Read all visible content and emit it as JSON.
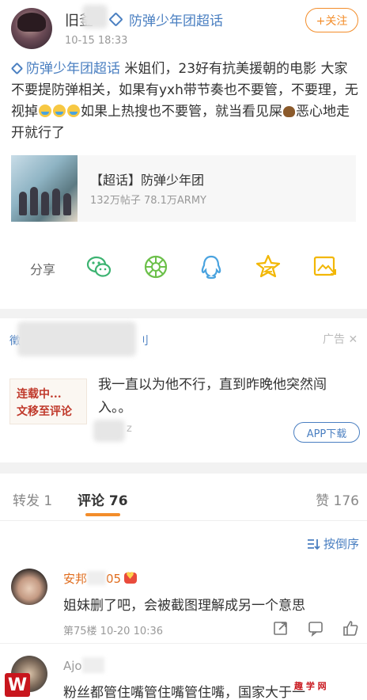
{
  "post": {
    "username": "旧釜",
    "super_topic_tag": "防弹少年团超话",
    "time": "10-15 18:33",
    "follow_label": "+关注",
    "topic_link": "防弹少年团超话",
    "body_1": " 米姐们，23好有抗美援朝的电影 大家不要提防弹相关，如果有yxh带节奏也不要管，不要理，无视掉",
    "body_2": "如果上热搜也不要管，就当看见屎",
    "body_3": "恶心地走开就行了",
    "emoji_icons": [
      "crying-face-icon",
      "crying-face-icon",
      "crying-face-icon"
    ],
    "poop_icon": "poop-icon"
  },
  "topic_card": {
    "title": "【超话】防弹少年团",
    "stats": "132万帖子 78.1万ARMY"
  },
  "share": {
    "label": "分享",
    "icons": [
      "wechat-icon",
      "moments-icon",
      "qq-icon",
      "qzone-icon",
      "save-image-icon"
    ]
  },
  "ad": {
    "advertiser": "徵",
    "advertiser_suffix": "刂",
    "label": "广告",
    "thumb_line_1": "连载中...",
    "thumb_line_2": "文移至评论",
    "text": "我一直以为他不行，直到昨晚他突然闯入。。",
    "meta": "z",
    "app_button": "APP下载"
  },
  "tabs": {
    "repost": "转发 1",
    "comments": "评论 76",
    "likes": "赞 176"
  },
  "sort": {
    "label": "按倒序"
  },
  "comments": [
    {
      "name": "安邦",
      "name_suffix": "05",
      "text": "姐妹删了吧，会被截图理解成另一个意思",
      "meta": "第75楼 10-20 10:36"
    },
    {
      "name": "Ajo",
      "text": "粉丝都管住嘴管住嘴管住嘴，国家大于一",
      "meta": ""
    }
  ],
  "watermark": {
    "logo": "W",
    "text": "趣 学 网"
  },
  "colors": {
    "accent_orange": "#f38d2a",
    "link_blue": "#4a7fc1",
    "name_orange": "#e06c1d"
  }
}
